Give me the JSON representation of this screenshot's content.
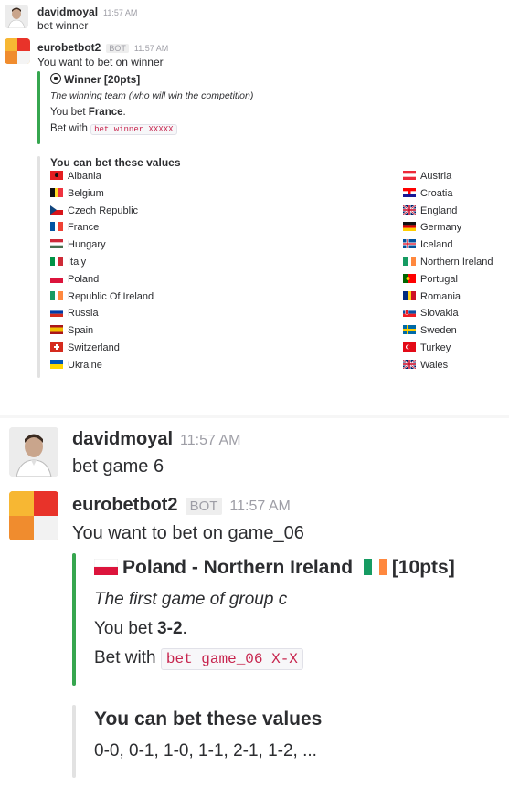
{
  "top": {
    "user_msg": {
      "username": "davidmoyal",
      "time": "11:57 AM",
      "text": "bet winner"
    },
    "bot_msg": {
      "username": "eurobetbot2",
      "badge": "BOT",
      "time": "11:57 AM",
      "text": "You want to bet on winner",
      "card": {
        "title": "Winner [20pts]",
        "description": "The winning team (who will win the competition)",
        "you_bet_prefix": "You bet ",
        "you_bet_value": "France",
        "you_bet_suffix": ".",
        "bet_with_label": "Bet with",
        "command": "bet winner XXXXX"
      },
      "values": {
        "header": "You can bet these values",
        "left": [
          {
            "name": "Albania",
            "flag": "albania-flag-icon"
          },
          {
            "name": "Belgium",
            "flag": "belgium-flag-icon"
          },
          {
            "name": "Czech Republic",
            "flag": "czech-flag-icon"
          },
          {
            "name": "France",
            "flag": "france-flag-icon"
          },
          {
            "name": "Hungary",
            "flag": "hungary-flag-icon"
          },
          {
            "name": "Italy",
            "flag": "italy-flag-icon"
          },
          {
            "name": "Poland",
            "flag": "poland-flag-icon"
          },
          {
            "name": "Republic Of Ireland",
            "flag": "ireland-flag-icon"
          },
          {
            "name": "Russia",
            "flag": "russia-flag-icon"
          },
          {
            "name": "Spain",
            "flag": "spain-flag-icon"
          },
          {
            "name": "Switzerland",
            "flag": "switzerland-flag-icon"
          },
          {
            "name": "Ukraine",
            "flag": "ukraine-flag-icon"
          }
        ],
        "right": [
          {
            "name": "Austria",
            "flag": "austria-flag-icon"
          },
          {
            "name": "Croatia",
            "flag": "croatia-flag-icon"
          },
          {
            "name": "England",
            "flag": "uk-flag-icon"
          },
          {
            "name": "Germany",
            "flag": "germany-flag-icon"
          },
          {
            "name": "Iceland",
            "flag": "iceland-flag-icon"
          },
          {
            "name": "Northern Ireland",
            "flag": "ireland-flag-icon"
          },
          {
            "name": "Portugal",
            "flag": "portugal-flag-icon"
          },
          {
            "name": "Romania",
            "flag": "romania-flag-icon"
          },
          {
            "name": "Slovakia",
            "flag": "slovakia-flag-icon"
          },
          {
            "name": "Sweden",
            "flag": "sweden-flag-icon"
          },
          {
            "name": "Turkey",
            "flag": "turkey-flag-icon"
          },
          {
            "name": "Wales",
            "flag": "uk-flag-icon"
          }
        ]
      }
    }
  },
  "bottom": {
    "user_msg": {
      "username": "davidmoyal",
      "time": "11:57 AM",
      "text": "bet game 6"
    },
    "bot_msg": {
      "username": "eurobetbot2",
      "badge": "BOT",
      "time": "11:57 AM",
      "text": "You want to bet on game_06",
      "card": {
        "title": "Poland - Northern Ireland",
        "points": "[10pts]",
        "description": "The first game of group c",
        "you_bet_prefix": "You bet ",
        "you_bet_value": "3-2",
        "you_bet_suffix": ".",
        "bet_with_label": "Bet with",
        "command": "bet game_06 X-X"
      },
      "values": {
        "header": "You can bet these values",
        "text": "0-0, 0-1, 1-0, 1-1, 2-1, 1-2, ..."
      }
    }
  },
  "colors": {
    "attachment_bar": "#36a64f",
    "values_bar": "#e2e2e2",
    "code_text": "#c7254e",
    "timestamp": "#9e9ea6"
  }
}
